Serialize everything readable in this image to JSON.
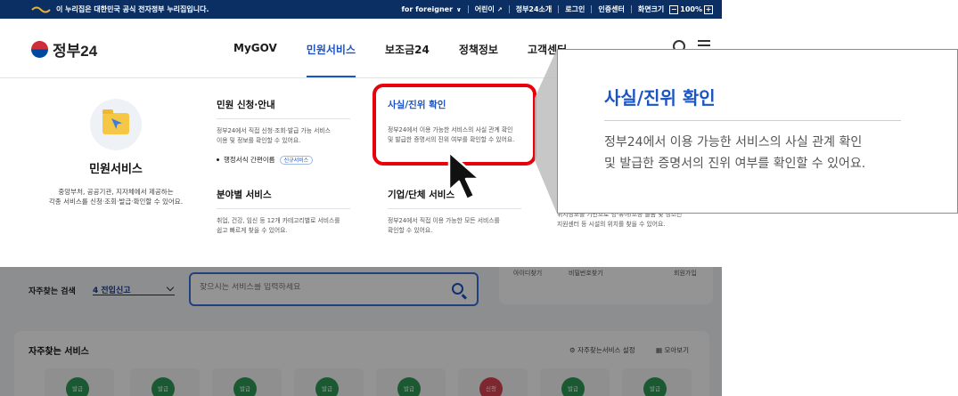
{
  "gov_banner": {
    "notice": "이 누리집은 대한민국 공식 전자정부 누리집입니다.",
    "links": [
      "for foreigner",
      "어린이",
      "정부24소개",
      "로그인",
      "인증센터",
      "화면크기"
    ],
    "zoom_level": "100%",
    "zoom_minus": "−",
    "zoom_plus": "+"
  },
  "header": {
    "brand": "정부24",
    "nav": [
      "MyGOV",
      "민원서비스",
      "보조금24",
      "정책정보",
      "고객센터"
    ],
    "active_nav": "민원서비스"
  },
  "mega_menu": {
    "intro": {
      "title": "민원서비스",
      "description_line1": "중앙부처, 공공기관, 지자체에서 제공하는",
      "description_line2": "각종 서비스를 신청·조회·발급·확인할 수 있어요."
    },
    "col1": {
      "title": "민원 신청·안내",
      "description_line1": "정부24에서 직접 신청·조회·발급 가능 서비스",
      "description_line2": "이용 및 정보를 확인할 수 있어요.",
      "link": "행정서식 간편이름",
      "badge": "신규서비스"
    },
    "col2": {
      "title": "사실/진위 확인",
      "description_line1": "정부24에서 이용 가능한 서비스의 사실 관계 확인",
      "description_line2": "및 발급한 증명서의 진위 여부를 확인할 수 있어요."
    },
    "col3": {
      "title": "분야별 서비스",
      "description_line1": "취업, 건강, 임신 등 12개 카테고리별로 서비스를",
      "description_line2": "쉽고 빠르게 찾을 수 있어요."
    },
    "col4": {
      "title": "기업/단체 서비스",
      "description_line1": "정부24에서 직접 이용 가능한 모든 서비스를",
      "description_line2": "확인할 수 있어요."
    },
    "col5": {
      "description_line1": "위치정보를 기반으로 영·유아/초등 돌봄 및 청소년",
      "description_line2": "지원센터 등 시설의 위치를 찾을 수 있어요."
    }
  },
  "callout": {
    "title": "사실/진위 확인",
    "description_line1": "정부24에서 이용 가능한 서비스의 사실 관계 확인",
    "description_line2": "및 발급한 증명서의 진위 여부를 확인할 수 있어요."
  },
  "lower": {
    "frequent_search_label": "자주찾는 검색",
    "frequent_search_value": "4 전입신고",
    "search_placeholder": "찾으시는 서비스를 입력하세요",
    "login_links": [
      "아이디찾기",
      "비밀번호찾기",
      "회원가입"
    ],
    "services_title": "자주찾는 서비스",
    "services_setting": "자주찾는서비스 설정",
    "services_view": "모아보기",
    "service_badges": [
      "발급",
      "발급",
      "발급",
      "발급",
      "발급",
      "신청",
      "발급",
      "발급"
    ]
  },
  "colors": {
    "brand_blue": "#1b55c5",
    "banner_navy": "#0b2f63",
    "highlight_red": "#e8000b"
  }
}
